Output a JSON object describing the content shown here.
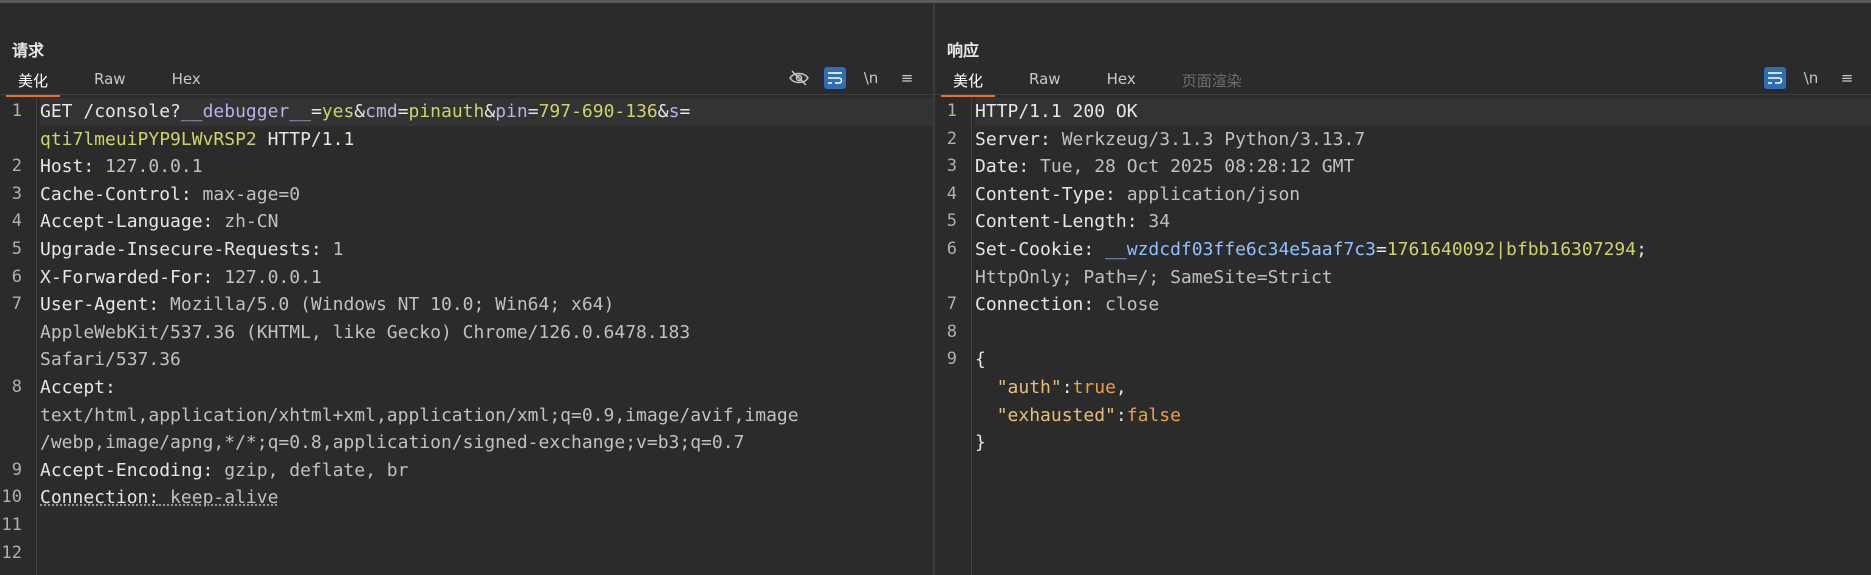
{
  "layout_toggles": [
    {
      "name": "side-by-side-icon",
      "active": true
    },
    {
      "name": "stacked-icon",
      "active": false
    },
    {
      "name": "single-pane-icon",
      "active": false
    }
  ],
  "request": {
    "title": "请求",
    "tabs": [
      "美化",
      "Raw",
      "Hex"
    ],
    "tools": {
      "eye_off": "",
      "wrap": "",
      "newline": "\\n",
      "menu": "≡"
    },
    "line_numbers": [
      "1",
      "2",
      "3",
      "4",
      "5",
      "6",
      "7",
      "8",
      "9",
      "10",
      "11",
      "12"
    ],
    "line1": {
      "method": "GET",
      "path": " /console?",
      "p1_name": "__debugger__",
      "p1_eq": "=",
      "p1_val": "yes",
      "amp1": "&",
      "p2_name": "cmd",
      "p2_eq": "=",
      "p2_val": "pinauth",
      "amp2": "&",
      "p3_name": "pin",
      "p3_eq": "=",
      "p3_val": "797-690-136",
      "amp3": "&",
      "p4_name": "s",
      "p4_eq": "=",
      "p4_val": "qti7lmeuiPYP9LWvRSP2",
      "proto": " HTTP/1.1"
    },
    "headers": [
      {
        "k": "Host:",
        "v": " 127.0.0.1"
      },
      {
        "k": "Cache-Control:",
        "v": " max-age=0"
      },
      {
        "k": "Accept-Language:",
        "v": " zh-CN"
      },
      {
        "k": "Upgrade-Insecure-Requests:",
        "v": " 1"
      },
      {
        "k": "X-Forwarded-For:",
        "v": " 127.0.0.1"
      },
      {
        "k": "User-Agent:",
        "v": " Mozilla/5.0 (Windows NT 10.0; Win64; x64)",
        "cont": [
          "AppleWebKit/537.36 (KHTML, like Gecko) Chrome/126.0.6478.183",
          "Safari/537.36"
        ]
      },
      {
        "k": "Accept:",
        "v": "",
        "cont": [
          "text/html,application/xhtml+xml,application/xml;q=0.9,image/avif,image",
          "/webp,image/apng,*/*;q=0.8,application/signed-exchange;v=b3;q=0.7"
        ]
      },
      {
        "k": "Accept-Encoding:",
        "v": " gzip, deflate, br"
      },
      {
        "k": "Connection:",
        "v": " keep-alive"
      }
    ]
  },
  "response": {
    "title": "响应",
    "tabs": [
      "美化",
      "Raw",
      "Hex",
      "页面渲染"
    ],
    "tools": {
      "wrap": "",
      "newline": "\\n",
      "menu": "≡"
    },
    "line_numbers": [
      "1",
      "2",
      "3",
      "4",
      "5",
      "6",
      "7",
      "8",
      "9"
    ],
    "status": "HTTP/1.1 200 OK",
    "headers": [
      {
        "k": "Server:",
        "v": " Werkzeug/3.1.3 Python/3.13.7"
      },
      {
        "k": "Date:",
        "v": " Tue, 28 Oct 2025 08:28:12 GMT"
      },
      {
        "k": "Content-Type:",
        "v": " application/json"
      },
      {
        "k": "Content-Length:",
        "v": " 34"
      }
    ],
    "cookie": {
      "k": "Set-Cookie:",
      "name": " __wzdcdf03ffe6c34e5aaf7c3",
      "eq": "=",
      "value": "1761640092|bfbb16307294",
      "rest": ";",
      "cont": "HttpOnly; Path=/; SameSite=Strict"
    },
    "connection": {
      "k": "Connection:",
      "v": " close"
    },
    "json": {
      "open": "{",
      "k1": "\"auth\"",
      "colon1": ":",
      "v1": "true",
      "comma1": ",",
      "k2": "\"exhausted\"",
      "colon2": ":",
      "v2": "false",
      "close": "}"
    }
  }
}
